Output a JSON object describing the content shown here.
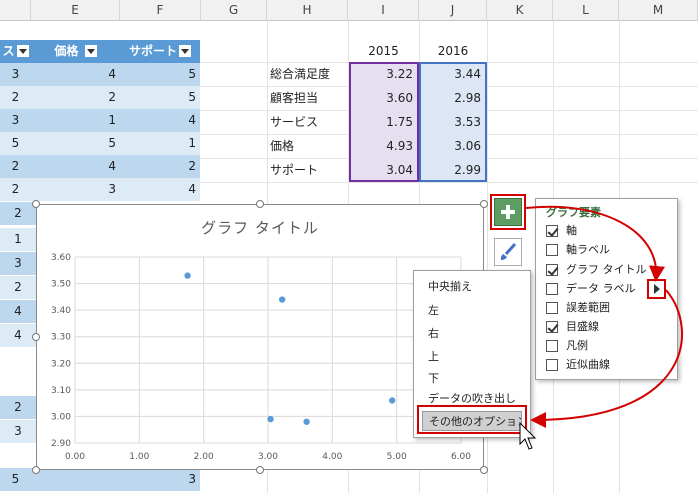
{
  "columns": [
    "E",
    "F",
    "G",
    "H",
    "I",
    "J",
    "K",
    "L",
    "M"
  ],
  "table": {
    "partial_header": "ス",
    "header_e": "価格",
    "header_f": "サポート",
    "rows": [
      {
        "d": "3",
        "e": "4",
        "f": "5"
      },
      {
        "d": "2",
        "e": "2",
        "f": "5"
      },
      {
        "d": "3",
        "e": "1",
        "f": "4"
      },
      {
        "d": "5",
        "e": "5",
        "f": "1"
      },
      {
        "d": "2",
        "e": "4",
        "f": "2"
      },
      {
        "d": "2",
        "e": "3",
        "f": "4"
      }
    ],
    "left_edge_values": [
      "2",
      "1",
      "3",
      "2",
      "4",
      "4",
      "2",
      "3",
      "5"
    ],
    "bottom_row": {
      "d": "5",
      "e": "",
      "f": "3"
    }
  },
  "summary": {
    "years": [
      "2015",
      "2016"
    ],
    "rows": [
      {
        "label": "総合満足度",
        "v2015": "3.22",
        "v2016": "3.44"
      },
      {
        "label": "顧客担当",
        "v2015": "3.60",
        "v2016": "2.98"
      },
      {
        "label": "サービス",
        "v2015": "1.75",
        "v2016": "3.53"
      },
      {
        "label": "価格",
        "v2015": "4.93",
        "v2016": "3.06"
      },
      {
        "label": "サポート",
        "v2015": "3.04",
        "v2016": "2.99"
      }
    ]
  },
  "chart_data": {
    "type": "scatter",
    "title": "グラフ タイトル",
    "x_ticks": [
      "0.00",
      "1.00",
      "2.00",
      "3.00",
      "4.00",
      "5.00",
      "6.00"
    ],
    "y_ticks": [
      "2.90",
      "3.00",
      "3.10",
      "3.20",
      "3.30",
      "3.40",
      "3.50",
      "3.60"
    ],
    "xlim": [
      0,
      6
    ],
    "ylim": [
      2.9,
      3.6
    ],
    "grid": true,
    "points": [
      {
        "x": 3.22,
        "y": 3.44
      },
      {
        "x": 3.6,
        "y": 2.98
      },
      {
        "x": 1.75,
        "y": 3.53
      },
      {
        "x": 4.93,
        "y": 3.06
      },
      {
        "x": 3.04,
        "y": 2.99
      }
    ],
    "point_color": "#5b9bd5"
  },
  "chart_elements": {
    "title": "グラフ要素",
    "items": [
      {
        "label": "軸",
        "checked": true
      },
      {
        "label": "軸ラベル",
        "checked": false
      },
      {
        "label": "グラフ タイトル",
        "checked": true
      },
      {
        "label": "データ ラベル",
        "checked": false
      },
      {
        "label": "誤差範囲",
        "checked": false
      },
      {
        "label": "目盛線",
        "checked": true
      },
      {
        "label": "凡例",
        "checked": false
      },
      {
        "label": "近似曲線",
        "checked": false
      }
    ]
  },
  "label_submenu": {
    "items": [
      "中央揃え",
      "左",
      "右",
      "上",
      "下",
      "データの吹き出し"
    ],
    "more_options": "その他のオプション..."
  },
  "icons": {
    "plus": "plus-icon",
    "brush": "brush-icon",
    "arrow": "triangle-right-icon",
    "cursor": "mouse-pointer-icon"
  },
  "colors": {
    "table_header": "#5b9bd5",
    "band_dark": "#bdd7ee",
    "band_light": "#ddebf7",
    "green_button": "#5e9e63",
    "highlight_red": "#d40000",
    "purple_range": "#7030a0",
    "blue_range": "#4472c4"
  }
}
